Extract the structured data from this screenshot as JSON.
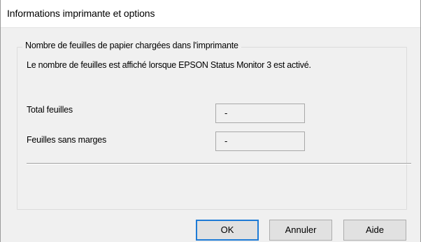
{
  "window": {
    "title": "Informations imprimante et options"
  },
  "paper_group": {
    "legend": "Nombre de feuilles de papier chargées dans l'imprimante",
    "info": "Le nombre de feuilles est affiché lorsque EPSON Status Monitor 3 est activé.",
    "rows": [
      {
        "label": "Total feuilles",
        "value": "-"
      },
      {
        "label": "Feuilles sans marges",
        "value": "-"
      }
    ]
  },
  "buttons": {
    "ok": "OK",
    "cancel": "Annuler",
    "help": "Aide"
  },
  "colors": {
    "dialog_background": "#f0f0f0",
    "titlebar_background": "#ffffff",
    "default_button_border": "#1e7bd6"
  }
}
